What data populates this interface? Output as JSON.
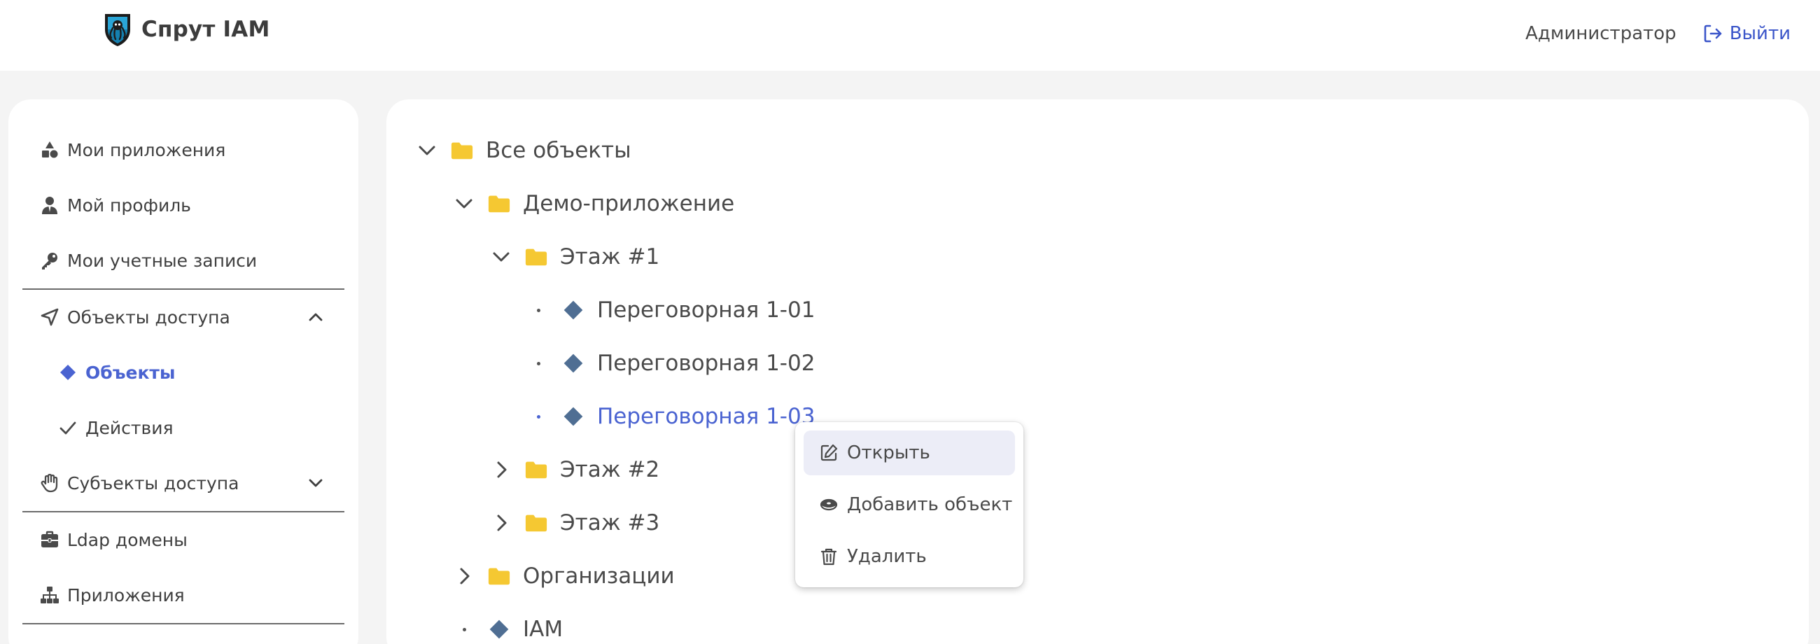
{
  "header": {
    "brand_title": "Спрут IAM",
    "user_name": "Администратор",
    "logout_label": "Выйти",
    "accent_color": "#3b55c9"
  },
  "sidebar": {
    "items": [
      {
        "label": "Мои приложения",
        "icon": "shapes-icon"
      },
      {
        "label": "Мой профиль",
        "icon": "user-tie-icon"
      },
      {
        "label": "Мои учетные записи",
        "icon": "key-icon"
      },
      {
        "label": "Объекты доступа",
        "icon": "location-arrow-icon",
        "expanded": true
      },
      {
        "label": "Объекты",
        "icon": "diamond-icon",
        "active": true
      },
      {
        "label": "Действия",
        "icon": "check-icon"
      },
      {
        "label": "Субъекты доступа",
        "icon": "hand-icon",
        "expanded": false
      },
      {
        "label": "Ldap домены",
        "icon": "briefcase-icon"
      },
      {
        "label": "Приложения",
        "icon": "sitemap-icon"
      }
    ]
  },
  "tree": {
    "nodes": [
      {
        "label": "Все объекты",
        "type": "folder",
        "state": "expanded"
      },
      {
        "label": "Демо-приложение",
        "type": "folder",
        "state": "expanded"
      },
      {
        "label": "Этаж #1",
        "type": "folder",
        "state": "expanded"
      },
      {
        "label": "Переговорная 1-01",
        "type": "object",
        "state": "leaf"
      },
      {
        "label": "Переговорная 1-02",
        "type": "object",
        "state": "leaf"
      },
      {
        "label": "Переговорная 1-03",
        "type": "object",
        "state": "leaf",
        "selected": true
      },
      {
        "label": "Этаж #2",
        "type": "folder",
        "state": "collapsed"
      },
      {
        "label": "Этаж #3",
        "type": "folder",
        "state": "collapsed"
      },
      {
        "label": "Организации",
        "type": "folder",
        "state": "collapsed"
      },
      {
        "label": "IAM",
        "type": "object",
        "state": "leaf"
      }
    ],
    "folder_color": "#f5c832",
    "object_color": "#4f6e93"
  },
  "context_menu": {
    "items": [
      {
        "label": "Открыть",
        "icon": "edit-icon"
      },
      {
        "label": "Добавить объект",
        "icon": "disk-icon"
      },
      {
        "label": "Удалить",
        "icon": "trash-icon"
      }
    ]
  }
}
